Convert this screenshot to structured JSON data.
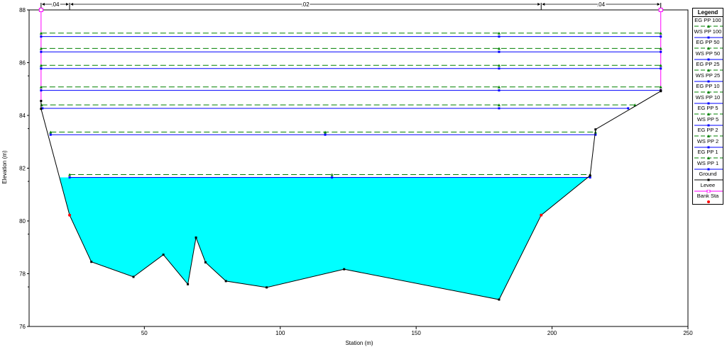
{
  "chart_data": {
    "type": "line",
    "title": "",
    "xlabel": "Station (m)",
    "ylabel": "Elevation (m)",
    "xlim": [
      0,
      250
    ],
    "ylim": [
      76,
      88
    ],
    "x_ticks": [
      "50",
      "100",
      "150",
      "200",
      "250"
    ],
    "y_ticks": [
      "76",
      "78",
      "80",
      "82",
      "84",
      "86",
      "88"
    ],
    "mannings_n": [
      {
        "label": ".04",
        "from": 12,
        "to": 22.5
      },
      {
        "label": ".02",
        "from": 22.5,
        "to": 196
      },
      {
        "label": ".04",
        "from": 196,
        "to": 240
      }
    ],
    "ground": {
      "name": "Ground",
      "color": "#000000",
      "points": [
        [
          12,
          84.55
        ],
        [
          12,
          84.25
        ],
        [
          22.5,
          80.22
        ],
        [
          30.5,
          78.45
        ],
        [
          46,
          77.88
        ],
        [
          57,
          78.72
        ],
        [
          66,
          77.6
        ],
        [
          69,
          79.37
        ],
        [
          72.5,
          78.43
        ],
        [
          80,
          77.72
        ],
        [
          95,
          77.48
        ],
        [
          123.5,
          78.17
        ],
        [
          180.5,
          77.02
        ],
        [
          196,
          80.22
        ],
        [
          214,
          81.72
        ],
        [
          216,
          83.47
        ],
        [
          240,
          84.92
        ],
        [
          240,
          84.95
        ]
      ]
    },
    "levee": {
      "name": "Levee",
      "color": "#ff00ff",
      "points": [
        [
          12,
          88
        ],
        [
          12,
          84.55
        ],
        [
          240,
          88
        ],
        [
          240,
          84.92
        ]
      ]
    },
    "bank_sta": {
      "name": "Bank Sta",
      "color": "#ff0000",
      "points": [
        [
          22.5,
          80.22
        ],
        [
          196,
          80.22
        ]
      ]
    },
    "fill_elevation": 81.65,
    "fill_color": "#00ffff",
    "series": [
      {
        "name": "EG PP 100",
        "kind": "EG",
        "y": 87.12,
        "x_start": 12,
        "x_end": 240,
        "color": "#008000"
      },
      {
        "name": "WS PP 100",
        "kind": "WS",
        "y": 86.99,
        "x_start": 12,
        "x_end": 240,
        "color": "#0000ff"
      },
      {
        "name": "EG PP 50",
        "kind": "EG",
        "y": 86.54,
        "x_start": 12,
        "x_end": 240,
        "color": "#008000"
      },
      {
        "name": "WS PP 50",
        "kind": "WS",
        "y": 86.41,
        "x_start": 12,
        "x_end": 240,
        "color": "#0000ff"
      },
      {
        "name": "EG PP 25",
        "kind": "EG",
        "y": 85.9,
        "x_start": 12,
        "x_end": 240,
        "color": "#008000"
      },
      {
        "name": "WS PP 25",
        "kind": "WS",
        "y": 85.78,
        "x_start": 12,
        "x_end": 240,
        "color": "#0000ff"
      },
      {
        "name": "EG PP 10",
        "kind": "EG",
        "y": 85.08,
        "x_start": 12,
        "x_end": 240,
        "color": "#008000"
      },
      {
        "name": "WS PP 10",
        "kind": "WS",
        "y": 84.95,
        "x_start": 12,
        "x_end": 240,
        "color": "#0000ff"
      },
      {
        "name": "EG PP 5",
        "kind": "EG",
        "y": 84.4,
        "x_start": 12.2,
        "x_end": 230.5,
        "color": "#008000"
      },
      {
        "name": "WS PP 5",
        "kind": "WS",
        "y": 84.27,
        "x_start": 12.5,
        "x_end": 228,
        "color": "#0000ff"
      },
      {
        "name": "EG PP 2",
        "kind": "EG",
        "y": 83.37,
        "x_start": 15.5,
        "x_end": 216,
        "color": "#008000"
      },
      {
        "name": "WS PP 2",
        "kind": "WS",
        "y": 83.27,
        "x_start": 15.5,
        "x_end": 216,
        "color": "#0000ff"
      },
      {
        "name": "EG PP 1",
        "kind": "EG",
        "y": 81.76,
        "x_start": 22.5,
        "x_end": 214,
        "color": "#008000"
      },
      {
        "name": "WS PP 1",
        "kind": "WS",
        "y": 81.65,
        "x_start": 22.5,
        "x_end": 214,
        "color": "#0000ff"
      }
    ],
    "legend": {
      "title": "Legend",
      "placement": "right",
      "items": [
        "EG PP 100",
        "WS PP 100",
        "EG PP 50",
        "WS PP 50",
        "EG PP 25",
        "WS PP 25",
        "EG PP 10",
        "WS PP 10",
        "EG PP 5",
        "WS PP 5",
        "EG PP 2",
        "WS PP 2",
        "EG PP 1",
        "WS PP 1",
        "Ground",
        "Levee",
        "Bank Sta"
      ]
    },
    "grid": false
  }
}
